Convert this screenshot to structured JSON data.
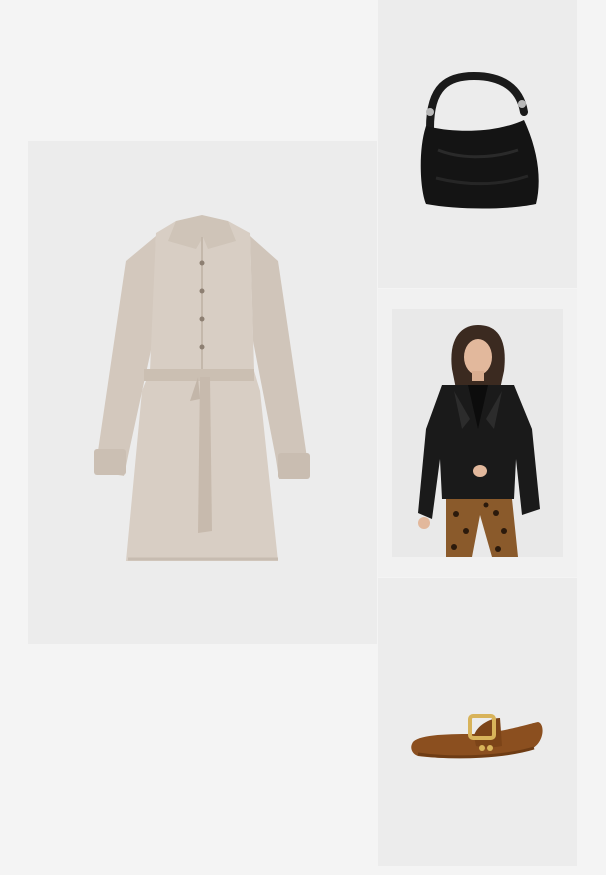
{
  "collage": {
    "items": [
      {
        "id": "dress",
        "icon": "shirt-dress-image"
      },
      {
        "id": "bag",
        "icon": "handbag-image"
      },
      {
        "id": "jacket",
        "icon": "leather-jacket-model-image"
      },
      {
        "id": "shoe",
        "icon": "ballet-flat-image"
      }
    ]
  },
  "colors": {
    "page_background": "#f4f4f4",
    "tile_background": "#ececec",
    "dress": "#d7cdc3",
    "bag": "#141414",
    "jacket": "#1a1a1a",
    "leopard": "#8a5a2b",
    "shoe": "#8b4f1f",
    "buckle": "#d8b35a"
  }
}
